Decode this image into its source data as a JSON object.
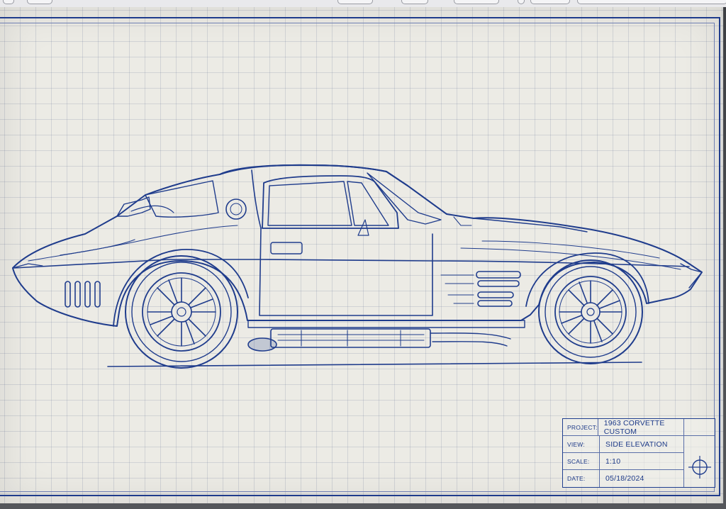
{
  "title_block": {
    "rows": [
      {
        "key": "PROJECT:",
        "value": "1963 CORVETTE CUSTOM"
      },
      {
        "key": "VIEW:",
        "value": "SIDE ELEVATION"
      },
      {
        "key": "SCALE:",
        "value": "1:10"
      },
      {
        "key": "DATE:",
        "value": "05/18/2024"
      }
    ]
  },
  "colors": {
    "paper": "#ecebe5",
    "ink": "#1f3c8c",
    "grid": "#b9bdd0"
  },
  "icons": {
    "registration_mark": "crosshair-icon"
  }
}
